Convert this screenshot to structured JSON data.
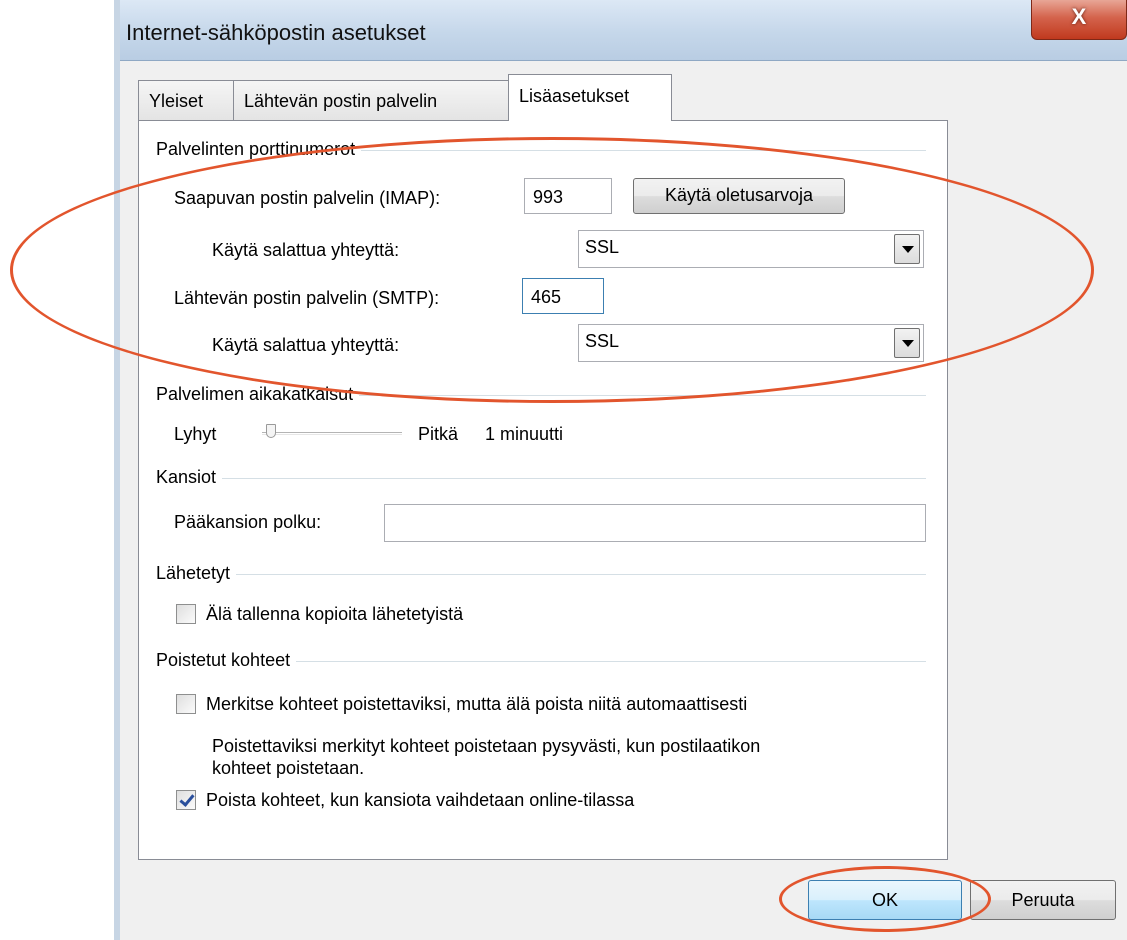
{
  "window": {
    "title": "Internet-sähköpostin asetukset",
    "close_label": "X"
  },
  "tabs": [
    {
      "label": "Yleiset",
      "active": false
    },
    {
      "label": "Lähtevän postin palvelin",
      "active": false
    },
    {
      "label": "Lisäasetukset",
      "active": true
    }
  ],
  "ports": {
    "group_title": "Palvelinten porttinumerot",
    "incoming_label": "Saapuvan postin palvelin (IMAP):",
    "incoming_value": "993",
    "defaults_button": "Käytä oletusarvoja",
    "incoming_encryption_label": "Käytä salattua yhteyttä:",
    "incoming_encryption_value": "SSL",
    "outgoing_label": "Lähtevän postin palvelin (SMTP):",
    "outgoing_value": "465",
    "outgoing_encryption_label": "Käytä salattua yhteyttä:",
    "outgoing_encryption_value": "SSL"
  },
  "timeouts": {
    "group_title": "Palvelimen aikakatkaisut",
    "short_label": "Lyhyt",
    "long_label": "Pitkä",
    "value_text": "1 minuutti",
    "slider_position": 0.05
  },
  "folders": {
    "group_title": "Kansiot",
    "root_path_label": "Pääkansion polku:",
    "root_path_value": ""
  },
  "sent": {
    "group_title": "Lähetetyt",
    "dont_save_label": "Älä tallenna kopioita lähetetyistä",
    "dont_save_checked": false
  },
  "deleted": {
    "group_title": "Poistetut kohteet",
    "mark_label": "Merkitse kohteet poistettaviksi, mutta älä poista niitä automaattisesti",
    "mark_checked": false,
    "info_line1": "Poistettaviksi merkityt kohteet poistetaan pysyvästi, kun postilaatikon",
    "info_line2": "kohteet poistetaan.",
    "purge_label": "Poista kohteet, kun kansiota vaihdetaan online-tilassa",
    "purge_checked": true
  },
  "footer": {
    "ok_label": "OK",
    "cancel_label": "Peruuta"
  },
  "colors": {
    "annotation": "#e2552d",
    "titlebar": "#c5d7ea",
    "close_button": "#c0391e"
  }
}
